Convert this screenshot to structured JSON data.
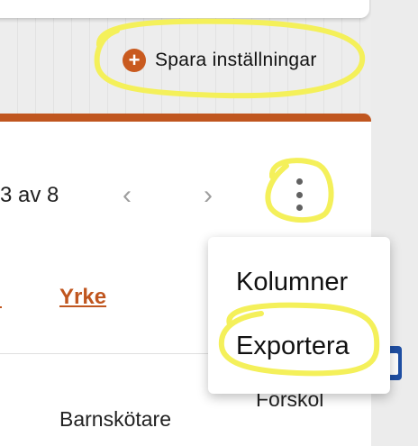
{
  "toolbar": {
    "save_label": "Spara inställningar"
  },
  "pager": {
    "text": "3 av 8",
    "prev_icon": "‹",
    "next_icon": "›"
  },
  "columns": {
    "yrke": "Yrke"
  },
  "rows": [
    {
      "yrke": "Barnskötare",
      "other": "Förskol"
    }
  ],
  "menu": {
    "items": [
      "Kolumner",
      "Exportera"
    ]
  },
  "colors": {
    "accent": "#c0561f",
    "highlight": "#f4f05a"
  },
  "icons": [
    "plus-circle-icon",
    "chevron-left-icon",
    "chevron-right-icon",
    "kebab-menu-icon",
    "calendar-icon"
  ]
}
